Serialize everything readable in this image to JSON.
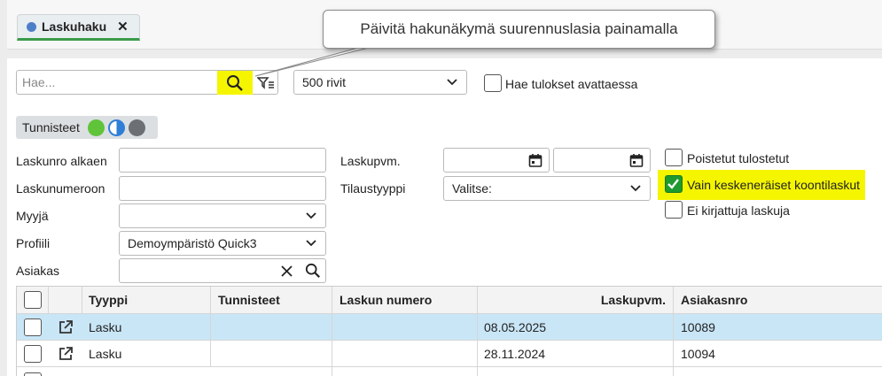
{
  "tab": {
    "label": "Laskuhaku",
    "close": "✕"
  },
  "tooltip": {
    "text": "Päivitä hakunäkymä suurennuslasia painamalla"
  },
  "search": {
    "placeholder": "Hae...",
    "value": ""
  },
  "rows_select": {
    "value": "500 rivit"
  },
  "auto_search": {
    "label": "Hae tulokset avattaessa",
    "checked": false
  },
  "identifiers": {
    "label": "Tunnisteet",
    "colors": [
      "#5fc43a",
      "#2f7fd6",
      "#6c6f73"
    ]
  },
  "filters": {
    "invoice_from": {
      "label": "Laskunro alkaen",
      "value": ""
    },
    "invoice_to": {
      "label": "Laskunumeroon",
      "value": ""
    },
    "seller": {
      "label": "Myyjä",
      "value": ""
    },
    "profile": {
      "label": "Profiili",
      "value": "Demoympäristö Quick3"
    },
    "customer": {
      "label": "Asiakas",
      "value": ""
    },
    "invoice_date": {
      "label": "Laskupvm.",
      "from": "",
      "to": ""
    },
    "order_type": {
      "label": "Tilaustyyppi",
      "value": "Valitse:"
    }
  },
  "options": [
    {
      "label": "Poistetut tulostetut",
      "checked": false
    },
    {
      "label": "Vain keskeneräiset koontilaskut",
      "checked": true
    },
    {
      "label": "Ei kirjattuja laskuja",
      "checked": false
    }
  ],
  "table": {
    "headers": {
      "type": "Tyyppi",
      "tags": "Tunnisteet",
      "number": "Laskun numero",
      "date": "Laskupvm.",
      "customer_no": "Asiakasnro"
    },
    "rows": [
      {
        "type": "Lasku",
        "tags": "",
        "number": "",
        "date": "08.05.2025",
        "customer_no": "10089",
        "selected": true
      },
      {
        "type": "Lasku",
        "tags": "",
        "number": "",
        "date": "28.11.2024",
        "customer_no": "10094",
        "selected": false
      }
    ]
  },
  "colors": {
    "highlight": "#f5f500",
    "selected_row": "#c9e6f7",
    "tab_underline": "#3a9a4a",
    "check_green": "#1f9a2e"
  }
}
